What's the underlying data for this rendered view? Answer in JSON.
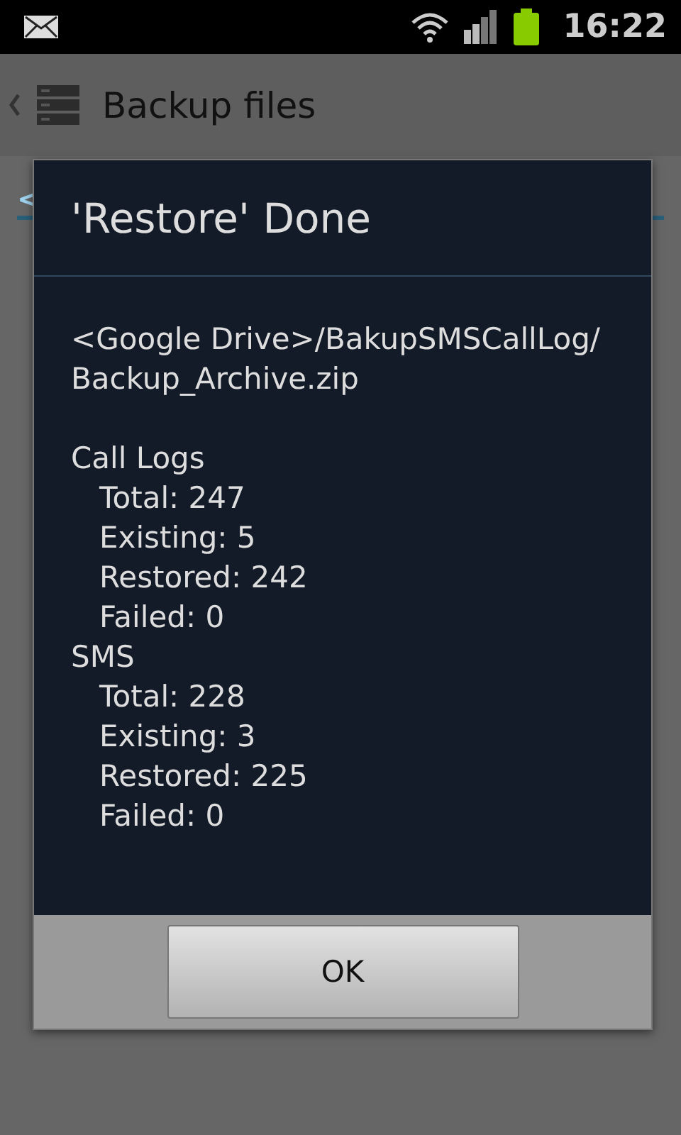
{
  "status_bar": {
    "time": "16:22"
  },
  "app_bar": {
    "title": "Backup files"
  },
  "behind": {
    "fragment": "<"
  },
  "dialog": {
    "title": "'Restore' Done",
    "path_lines": [
      "<Google Drive>/BakupSMSCallLog/",
      "Backup_Archive.zip"
    ],
    "sections": [
      {
        "title": "Call Logs",
        "items": [
          "Total: 247",
          "Existing: 5",
          "Restored: 242",
          "Failed: 0"
        ]
      },
      {
        "title": "SMS",
        "items": [
          "Total: 228",
          "Existing: 3",
          "Restored: 225",
          "Failed: 0"
        ]
      }
    ],
    "buttons": [
      "OK"
    ]
  }
}
